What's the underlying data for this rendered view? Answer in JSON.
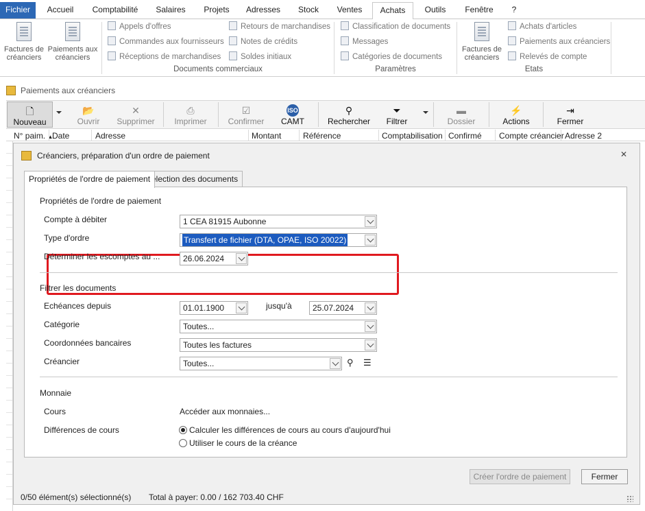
{
  "menu": {
    "tabs": [
      "Fichier",
      "Accueil",
      "Comptabilité",
      "Salaires",
      "Projets",
      "Adresses",
      "Stock",
      "Ventes",
      "Achats",
      "Outils",
      "Fenêtre",
      "?"
    ],
    "active": "Achats"
  },
  "ribbon": {
    "big_factures": "Factures de créanciers",
    "big_paiements": "Paiements aux créanciers",
    "col1": [
      "Appels d'offres",
      "Commandes aux fournisseurs",
      "Réceptions de marchandises"
    ],
    "col2": [
      "Retours de marchandises",
      "Notes de crédits",
      "Soldes initiaux"
    ],
    "group_docs": "Documents commerciaux",
    "col3": [
      "Classification de documents",
      "Messages",
      "Catégories de documents"
    ],
    "group_params": "Paramètres",
    "big_factures2": "Factures de créanciers",
    "col4": [
      "Achats d'articles",
      "Paiements aux créanciers",
      "Relevés de compte"
    ],
    "group_etats": "Etats"
  },
  "window_title": "Paiements aux créanciers",
  "toolbar": {
    "nouveau": "Nouveau",
    "ouvrir": "Ouvrir",
    "supprimer": "Supprimer",
    "imprimer": "Imprimer",
    "confirmer": "Confirmer",
    "camt": "CAMT",
    "rechercher": "Rechercher",
    "filtrer": "Filtrer",
    "dossier": "Dossier",
    "actions": "Actions",
    "fermer": "Fermer"
  },
  "columns": [
    "N° paim.",
    "Date",
    "Adresse",
    "Montant",
    "Référence",
    "Comptabilisation",
    "Confirmé",
    "Compte créancier",
    "Adresse 2"
  ],
  "dialog": {
    "title": "Créanciers, préparation d'un ordre de paiement",
    "tabs": [
      "Propriétés de l'ordre de paiement",
      "Sélection des documents"
    ],
    "sec1_title": "Propriétés de l'ordre de paiement",
    "compte_label": "Compte à débiter",
    "compte_value": "1 CEA 81915 Aubonne",
    "type_label": "Type d'ordre",
    "type_value": "Transfert de fichier (DTA, OPAE, ISO 20022)",
    "escomptes_label": "Déterminer les escomptes au ...",
    "escomptes_value": "26.06.2024",
    "sec2_title": "Filtrer les documents",
    "echeances_label": "Echéances depuis",
    "echeances_from": "01.01.1900",
    "jusqua_label": "jusqu'à",
    "echeances_to": "25.07.2024",
    "categorie_label": "Catégorie",
    "categorie_value": "Toutes...",
    "coord_label": "Coordonnées bancaires",
    "coord_value": "Toutes les factures",
    "creancier_label": "Créancier",
    "creancier_value": "Toutes...",
    "sec3_title": "Monnaie",
    "cours_label": "Cours",
    "cours_link": "Accéder aux monnaies...",
    "diff_label": "Différences de cours",
    "radio1": "Calculer les différences de cours au cours d'aujourd'hui",
    "radio2": "Utiliser le cours de la créance",
    "btn_create": "Créer l'ordre de paiement",
    "btn_close": "Fermer"
  },
  "status": {
    "selected": "0/50 élément(s) sélectionné(s)",
    "total": "Total à payer: 0.00 / 162 703.40 CHF"
  }
}
